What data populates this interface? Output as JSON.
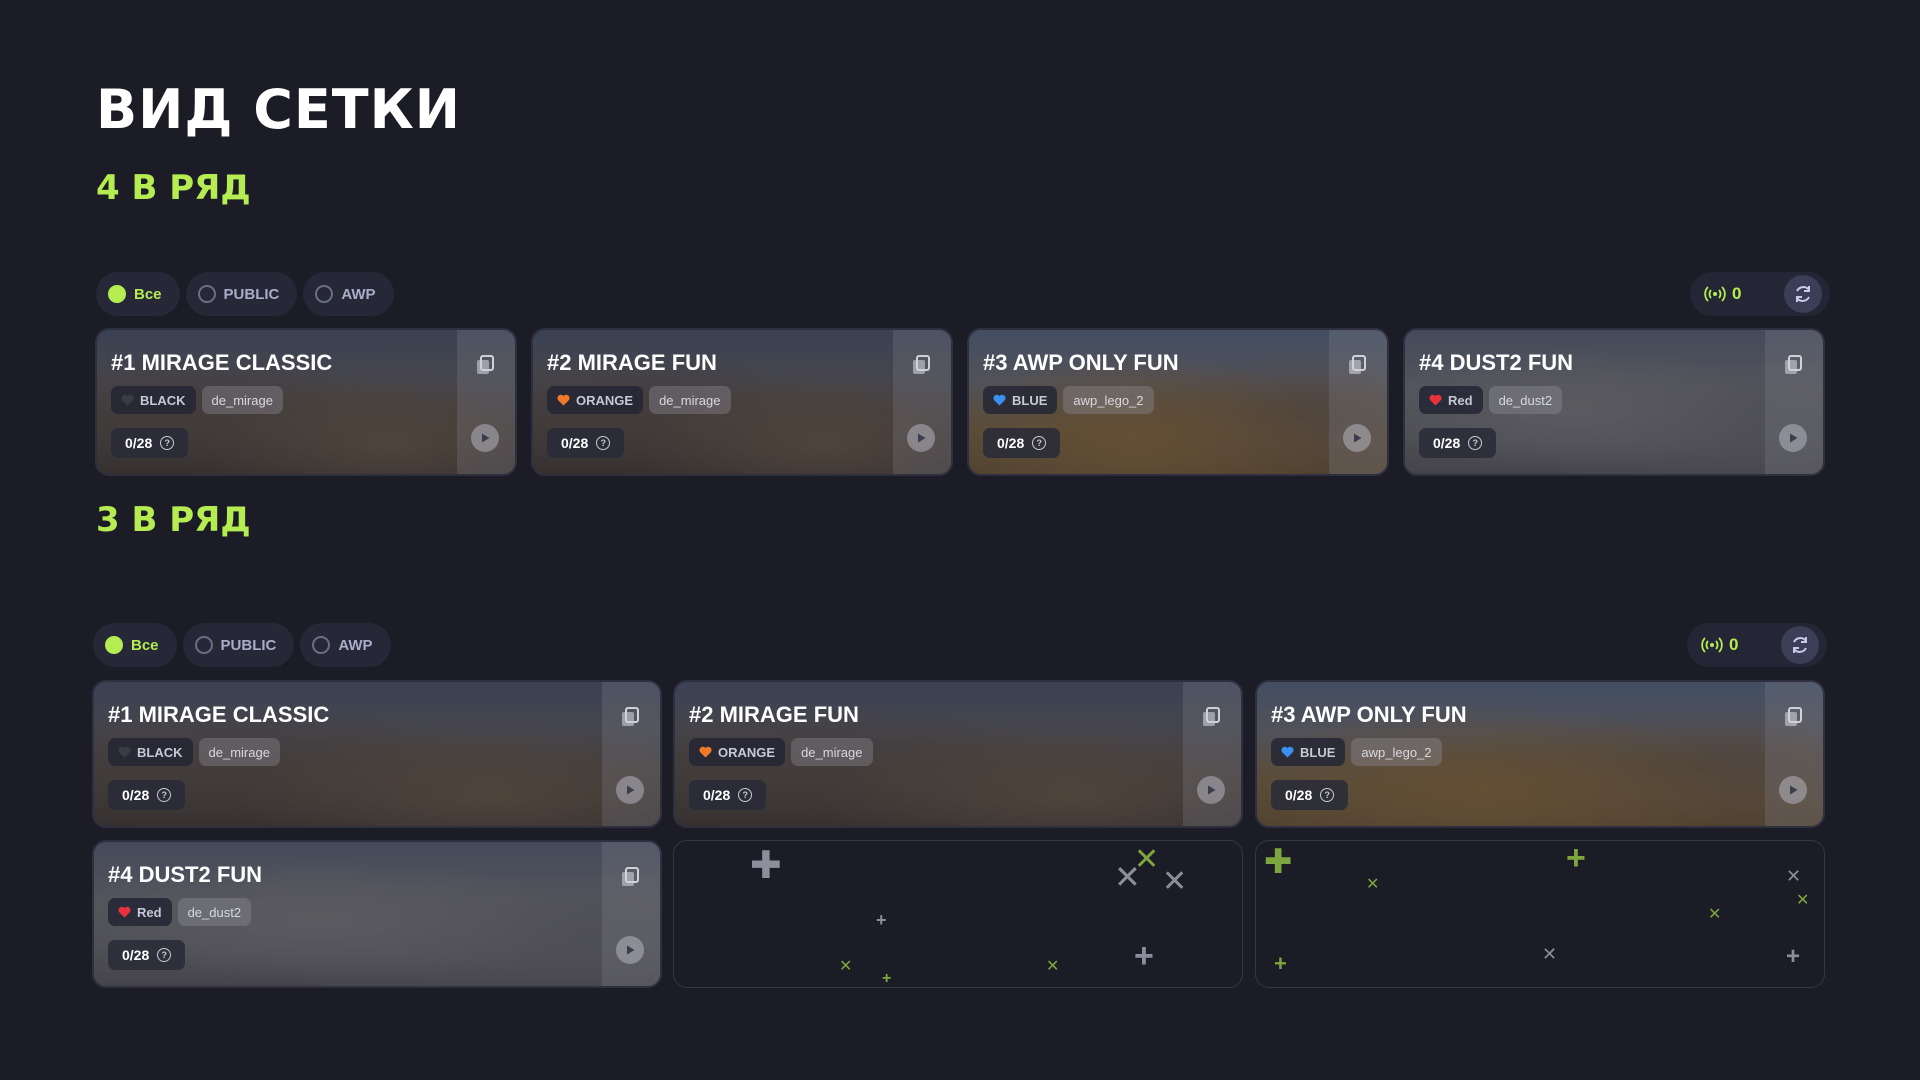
{
  "page_title": "ВИД СЕТКИ",
  "sections": [
    {
      "title": "4 В РЯД",
      "filters": [
        {
          "label": "Все",
          "active": true
        },
        {
          "label": "PUBLIC",
          "active": false
        },
        {
          "label": "AWP",
          "active": false
        }
      ],
      "online_count": "0"
    },
    {
      "title": "3 В РЯД",
      "filters": [
        {
          "label": "Все",
          "active": true
        },
        {
          "label": "PUBLIC",
          "active": false
        },
        {
          "label": "AWP",
          "active": false
        }
      ],
      "online_count": "0"
    }
  ],
  "servers": [
    {
      "title": "#1 MIRAGE CLASSIC",
      "team": "BLACK",
      "team_color": "#3a3b44",
      "map": "de_mirage",
      "players": "0/28"
    },
    {
      "title": "#2 MIRAGE FUN",
      "team": "ORANGE",
      "team_color": "#f07a2a",
      "map": "de_mirage",
      "players": "0/28"
    },
    {
      "title": "#3 AWP ONLY FUN",
      "team": "BLUE",
      "team_color": "#3a8ff0",
      "map": "awp_lego_2",
      "players": "0/28"
    },
    {
      "title": "#4 DUST2 FUN",
      "team": "Red",
      "team_color": "#e8323c",
      "map": "de_dust2",
      "players": "0/28"
    }
  ],
  "icons": {
    "online": "broadcast-icon",
    "refresh": "refresh-icon",
    "copy": "copy-icon",
    "play": "play-icon",
    "help": "help-icon",
    "team": "heart-icon"
  },
  "colors": {
    "accent": "#b4ec51",
    "background": "#1b1c26",
    "chip": "#262837"
  }
}
